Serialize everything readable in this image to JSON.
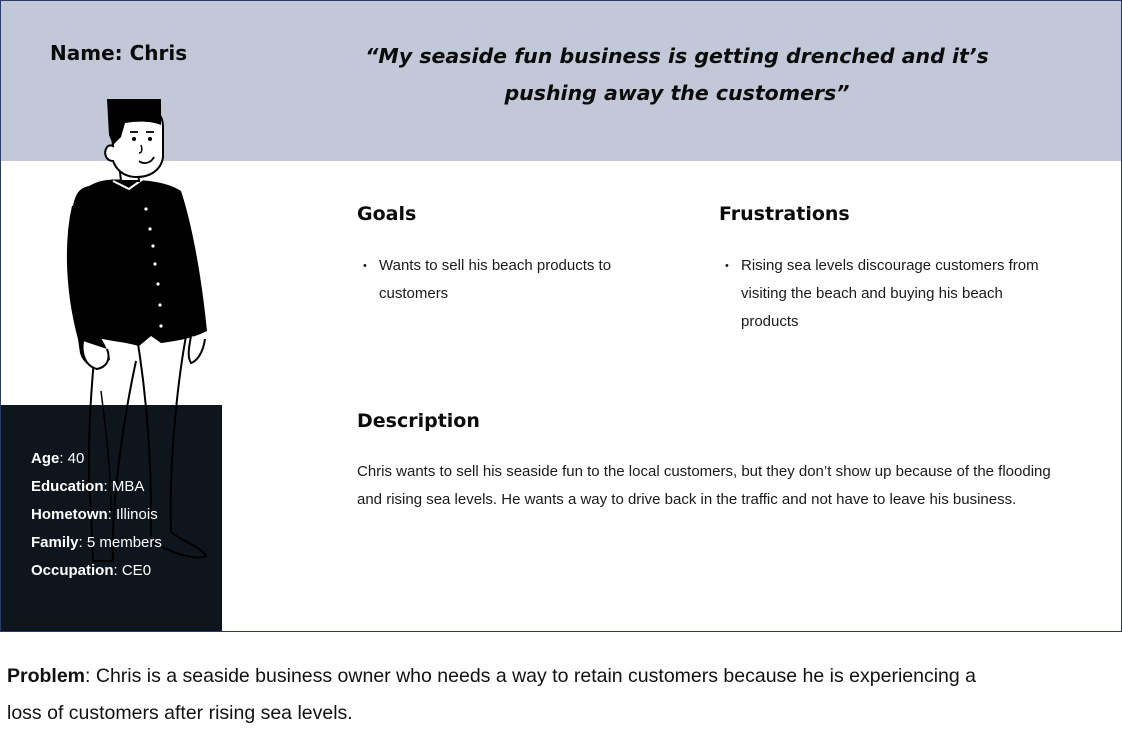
{
  "persona": {
    "name": "Name: Chris",
    "quote": "“My seaside fun business is getting drenched and it’s pushing away the customers”"
  },
  "info": {
    "age_label": "Age",
    "age_value": ": 40",
    "education_label": "Education",
    "education_value": ": MBA",
    "hometown_label": "Hometown",
    "hometown_value": ": Illinois",
    "family_label": "Family",
    "family_value": ": 5 members",
    "occupation_label": "Occupation",
    "occupation_value": ": CE0"
  },
  "goals": {
    "title": "Goals",
    "items": [
      "Wants to sell his beach products to customers"
    ]
  },
  "frustrations": {
    "title": "Frustrations",
    "items": [
      "Rising sea levels discourage customers from visiting the beach and buying his beach products"
    ]
  },
  "description": {
    "title": "Description",
    "text": "Chris wants to sell his seaside fun to the local customers, but they don’t show up because of the flooding and rising sea levels. He wants a way to drive back in the traffic and not have to leave his business."
  },
  "problem": {
    "label": "Problem",
    "text": ": Chris is a seaside business owner who needs a way to retain customers because he is experiencing a loss of customers after rising sea levels."
  },
  "colors": {
    "header_band": "#c3c8d8",
    "info_panel": "#0f151d",
    "card_border": "#2b3a67"
  }
}
